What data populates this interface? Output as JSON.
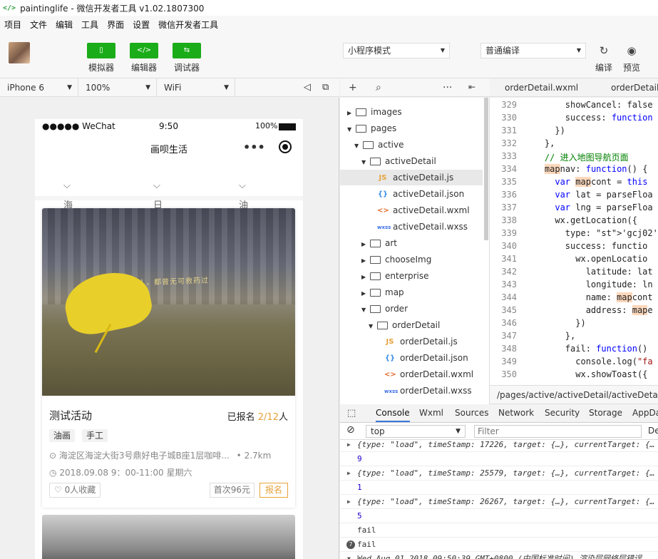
{
  "window": {
    "title": "paintinglife - 微信开发者工具 v1.02.1807300"
  },
  "menu": [
    "项目",
    "文件",
    "编辑",
    "工具",
    "界面",
    "设置",
    "微信开发者工具"
  ],
  "toolbar": {
    "simulator": "模拟器",
    "editor": "编辑器",
    "debugger": "调试器",
    "mode": "小程序模式",
    "compile": "普通编译",
    "compile_btn": "编译",
    "preview_btn": "预览"
  },
  "device_bar": {
    "device": "iPhone 6",
    "zoom": "100%",
    "network": "WiFi"
  },
  "phone": {
    "carrier": "●●●●● WeChat",
    "time": "9:50",
    "battery": "100%",
    "nav_title": "画呗生活",
    "filters": [
      "海淀区",
      "日期",
      "油画"
    ],
    "card": {
      "image_text": "有些不被的人，都曾无可救药过",
      "title": "测试活动",
      "reg_prefix": "已报名 ",
      "reg_count": "2/12",
      "reg_suffix": "人",
      "tags": [
        "油画",
        "手工"
      ],
      "address": "海淀区海淀大街3号鼎好电子城B座1层咖啡...",
      "distance": "• 2.7km",
      "datetime": "2018.09.08  9：00-11:00  星期六",
      "favorites": "0人收藏",
      "price": "首次96元",
      "signup": "报名"
    }
  },
  "editor_tabs": [
    "orderDetail.wxml",
    "orderDetail."
  ],
  "file_tree": [
    {
      "label": "images",
      "type": "folder",
      "depth": 0,
      "expanded": false
    },
    {
      "label": "pages",
      "type": "folder",
      "depth": 0,
      "expanded": true
    },
    {
      "label": "active",
      "type": "folder",
      "depth": 1,
      "expanded": true
    },
    {
      "label": "activeDetail",
      "type": "folder",
      "depth": 2,
      "expanded": true
    },
    {
      "label": "activeDetail.js",
      "type": "js",
      "depth": 3,
      "selected": true
    },
    {
      "label": "activeDetail.json",
      "type": "json",
      "depth": 3
    },
    {
      "label": "activeDetail.wxml",
      "type": "wxml",
      "depth": 3
    },
    {
      "label": "activeDetail.wxss",
      "type": "wxss",
      "depth": 3
    },
    {
      "label": "art",
      "type": "folder",
      "depth": 2,
      "expanded": false
    },
    {
      "label": "chooseImg",
      "type": "folder",
      "depth": 2,
      "expanded": false
    },
    {
      "label": "enterprise",
      "type": "folder",
      "depth": 2,
      "expanded": false
    },
    {
      "label": "map",
      "type": "folder",
      "depth": 2,
      "expanded": false
    },
    {
      "label": "order",
      "type": "folder",
      "depth": 2,
      "expanded": true
    },
    {
      "label": "orderDetail",
      "type": "folder",
      "depth": 3,
      "expanded": true
    },
    {
      "label": "orderDetail.js",
      "type": "js",
      "depth": 4
    },
    {
      "label": "orderDetail.json",
      "type": "json",
      "depth": 4
    },
    {
      "label": "orderDetail.wxml",
      "type": "wxml",
      "depth": 4
    },
    {
      "label": "orderDetail.wxss",
      "type": "wxss",
      "depth": 4
    }
  ],
  "code": [
    {
      "n": "329",
      "t": "        showCancel: false"
    },
    {
      "n": "330",
      "t": "        success: function"
    },
    {
      "n": "331",
      "t": "      })"
    },
    {
      "n": "332",
      "t": "    },"
    },
    {
      "n": "333",
      "t": "    // 进入地图导航页面"
    },
    {
      "n": "334",
      "t": "    mapnav: function() {"
    },
    {
      "n": "335",
      "t": "      var mapcont = this"
    },
    {
      "n": "336",
      "t": "      var lat = parseFloa"
    },
    {
      "n": "337",
      "t": "      var lng = parseFloa"
    },
    {
      "n": "338",
      "t": "      wx.getLocation({"
    },
    {
      "n": "339",
      "t": "        type: 'gcj02', /"
    },
    {
      "n": "340",
      "t": "        success: functio"
    },
    {
      "n": "341",
      "t": "          wx.openLocatio"
    },
    {
      "n": "342",
      "t": "            latitude: lat"
    },
    {
      "n": "343",
      "t": "            longitude: ln"
    },
    {
      "n": "344",
      "t": "            name: mapcont"
    },
    {
      "n": "345",
      "t": "            address: mape"
    },
    {
      "n": "346",
      "t": "          })"
    },
    {
      "n": "347",
      "t": "        },"
    },
    {
      "n": "348",
      "t": "        fail: function()"
    },
    {
      "n": "349",
      "t": "          console.log(\"fa"
    },
    {
      "n": "350",
      "t": "          wx.showToast({"
    }
  ],
  "file_path": "/pages/active/activeDetail/activeDetail.js",
  "devtools_tabs": [
    "Console",
    "Wxml",
    "Sources",
    "Network",
    "Security",
    "Storage",
    "AppDa"
  ],
  "console_bar": {
    "context": "top",
    "filter_placeholder": "Filter",
    "level": "De"
  },
  "console_rows": [
    {
      "kind": "obj",
      "text": "{type: \"load\", timeStamp: 17226, target: {…}, currentTarget: {…"
    },
    {
      "kind": "num",
      "text": "9"
    },
    {
      "kind": "obj",
      "text": "{type: \"load\", timeStamp: 25579, target: {…}, currentTarget: {…"
    },
    {
      "kind": "num",
      "text": "1"
    },
    {
      "kind": "obj",
      "text": "{type: \"load\", timeStamp: 26267, target: {…}, currentTarget: {…"
    },
    {
      "kind": "num",
      "text": "5"
    },
    {
      "kind": "plain",
      "text": "fail"
    },
    {
      "kind": "badge",
      "text": "fail",
      "badge": "7"
    },
    {
      "kind": "obj",
      "text": "Wed Aug 01 2018 09:50:39 GMT+0800 (中国标准时间) 渲染层网络层错误"
    }
  ]
}
